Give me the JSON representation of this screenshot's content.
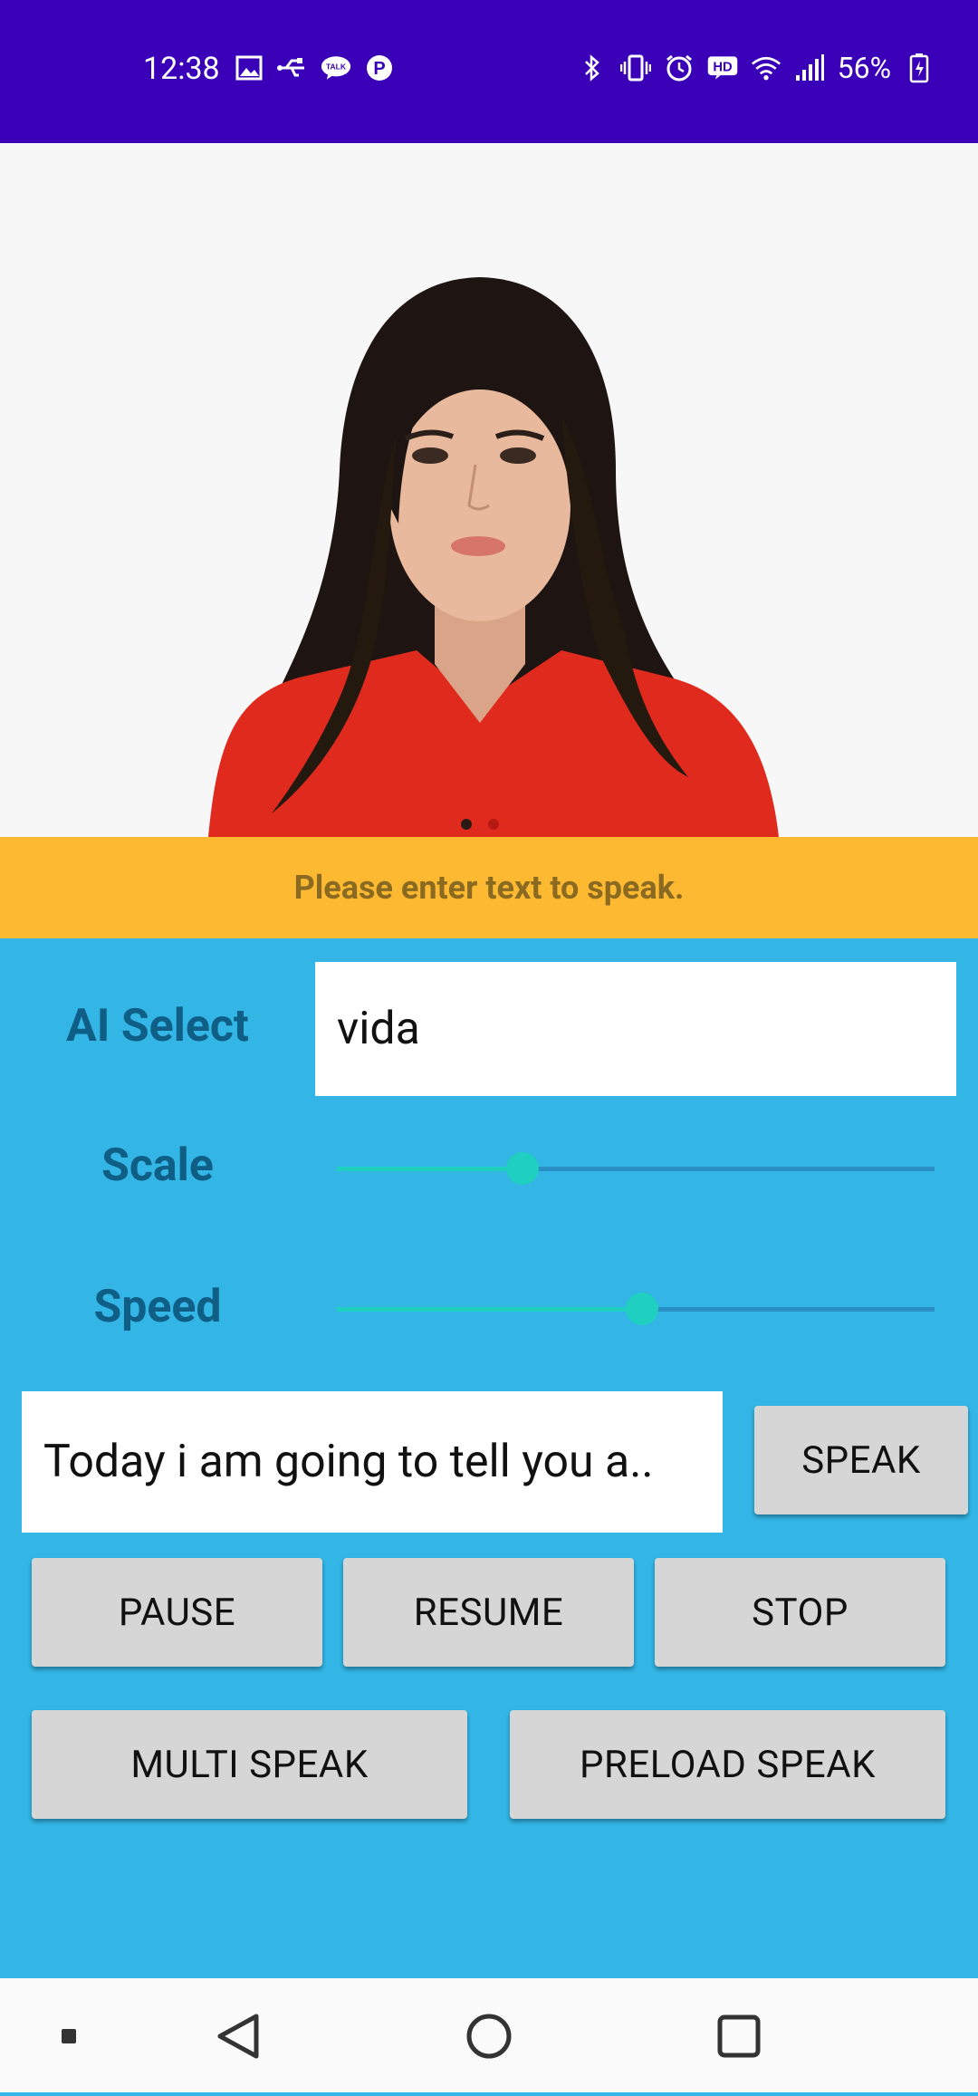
{
  "status_bar": {
    "time": "12:38",
    "battery": "56%",
    "left_icons": [
      "gallery-icon",
      "usb-icon",
      "talk-icon",
      "p-icon"
    ],
    "right_icons": [
      "bluetooth-icon",
      "vibrate-icon",
      "alarm-icon",
      "hd-icon",
      "wifi-icon",
      "signal-icon",
      "battery-icon"
    ]
  },
  "notice": {
    "text": "Please enter text to speak."
  },
  "form": {
    "ai_select_label": "AI Select",
    "ai_select_value": "vida",
    "scale_label": "Scale",
    "scale_value": 0.31,
    "speed_label": "Speed",
    "speed_value": 0.51,
    "speech_text": "Today i am going to tell you a.."
  },
  "buttons": {
    "speak": "SPEAK",
    "pause": "PAUSE",
    "resume": "RESUME",
    "stop": "STOP",
    "multi_speak": "MULTI SPEAK",
    "preload_speak": "PRELOAD SPEAK"
  },
  "colors": {
    "status_bar": "#3a00b8",
    "notice_bg": "#fdb931",
    "panel_bg": "#33b5e5",
    "slider_accent": "#1fd0c0"
  }
}
